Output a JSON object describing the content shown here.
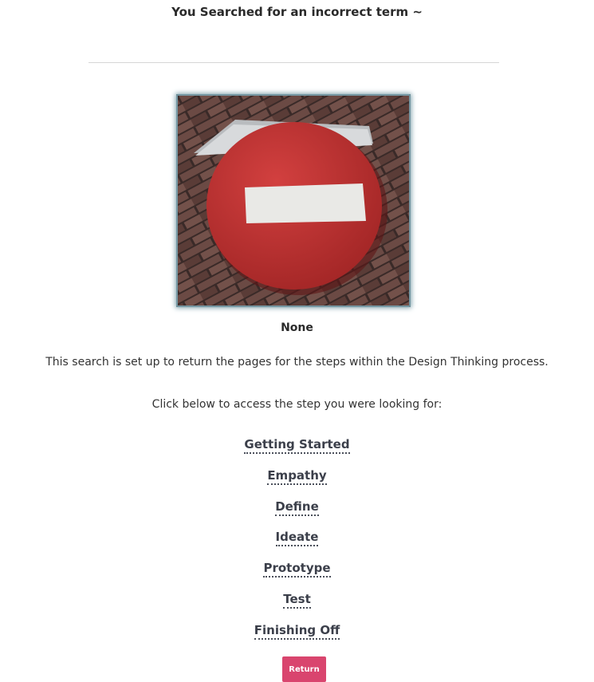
{
  "header": {
    "title": "You Searched for an incorrect term ~"
  },
  "image": {
    "icon": "no-entry-sign-icon"
  },
  "caption": "None",
  "description": "This search is set up to return the pages for the steps within the Design Thinking process.",
  "instruction": "Click below to access the step you were looking for:",
  "steps": [
    {
      "label": "Getting Started"
    },
    {
      "label": "Empathy"
    },
    {
      "label": "Define"
    },
    {
      "label": "Ideate"
    },
    {
      "label": "Prototype"
    },
    {
      "label": "Test"
    },
    {
      "label": "Finishing Off"
    }
  ],
  "return_button": {
    "label": "Return",
    "color": "#d9456e"
  }
}
